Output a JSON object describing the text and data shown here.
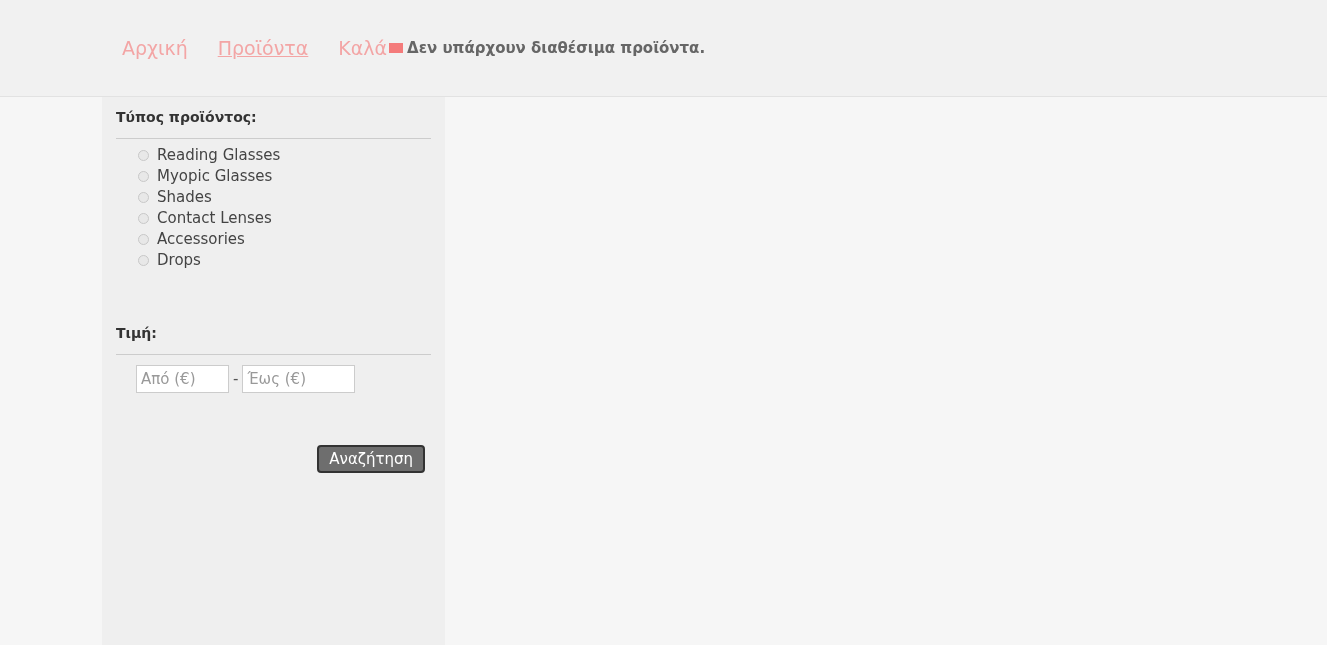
{
  "nav": [
    {
      "label": "Αρχική",
      "selected": false
    },
    {
      "label": "Προϊόντα",
      "selected": true
    },
    {
      "label": "Καλά",
      "selected": false
    }
  ],
  "message": "Δεν υπάρχουν διαθέσιμα προϊόντα.",
  "filters": {
    "type_title": "Τύπος προϊόντος:",
    "types": [
      {
        "label": "Reading Glasses",
        "selected": false
      },
      {
        "label": "Myopic Glasses",
        "selected": false
      },
      {
        "label": "Shades",
        "selected": false
      },
      {
        "label": "Contact Lenses",
        "selected": false
      },
      {
        "label": "Accessories",
        "selected": false
      },
      {
        "label": "Drops",
        "selected": false
      }
    ],
    "price_title": "Τιμή:",
    "from_placeholder": "Από (€)",
    "separator": "-",
    "to_placeholder": "Έως (€)",
    "search_button": "Αναζήτηση"
  }
}
